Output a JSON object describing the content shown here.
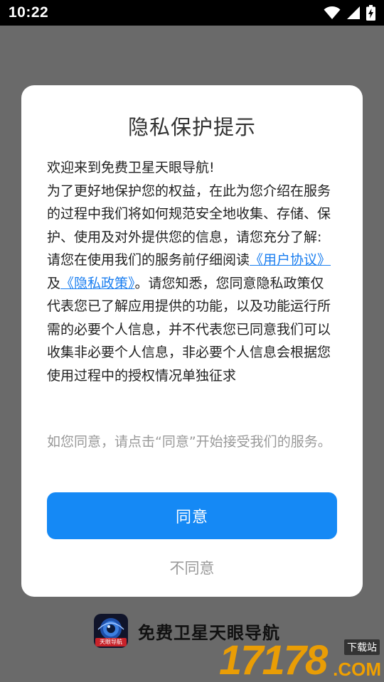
{
  "status_bar": {
    "time": "10:22"
  },
  "dialog": {
    "title": "隐私保护提示",
    "intro_line": "欢迎来到免费卫星天眼导航!",
    "paragraph_1": "为了更好地保护您的权益，在此为您介绍在服务的过程中我们将如何规范安全地收集、存储、保护、使用及对外提供您的信息，请您充分了解:",
    "paragraph_2_prefix": "请您在使用我们的服务前仔细阅读",
    "user_agreement_link": "《用户协议》",
    "and_text": "及",
    "privacy_policy_link": "《隐私政策》",
    "paragraph_2_suffix": "。请您知悉，您同意隐私政策仅代表您已了解应用提供的功能，以及功能运行所需的必要个人信息，并不代表您已同意我们可以收集非必要个人信息，非必要个人信息会根据您使用过程中的授权情况单独征求",
    "note": "如您同意，请点击“同意”开始接受我们的服务。",
    "agree_label": "同意",
    "disagree_label": "不同意"
  },
  "app": {
    "name": "免费卫星天眼导航",
    "logo_badge": "天眼导航"
  },
  "watermark": {
    "digits": "17178",
    "com": ".COM",
    "tag": "下载站"
  },
  "colors": {
    "accent": "#1589f5",
    "link": "#1a7ef0",
    "watermark": "#f0a000"
  }
}
